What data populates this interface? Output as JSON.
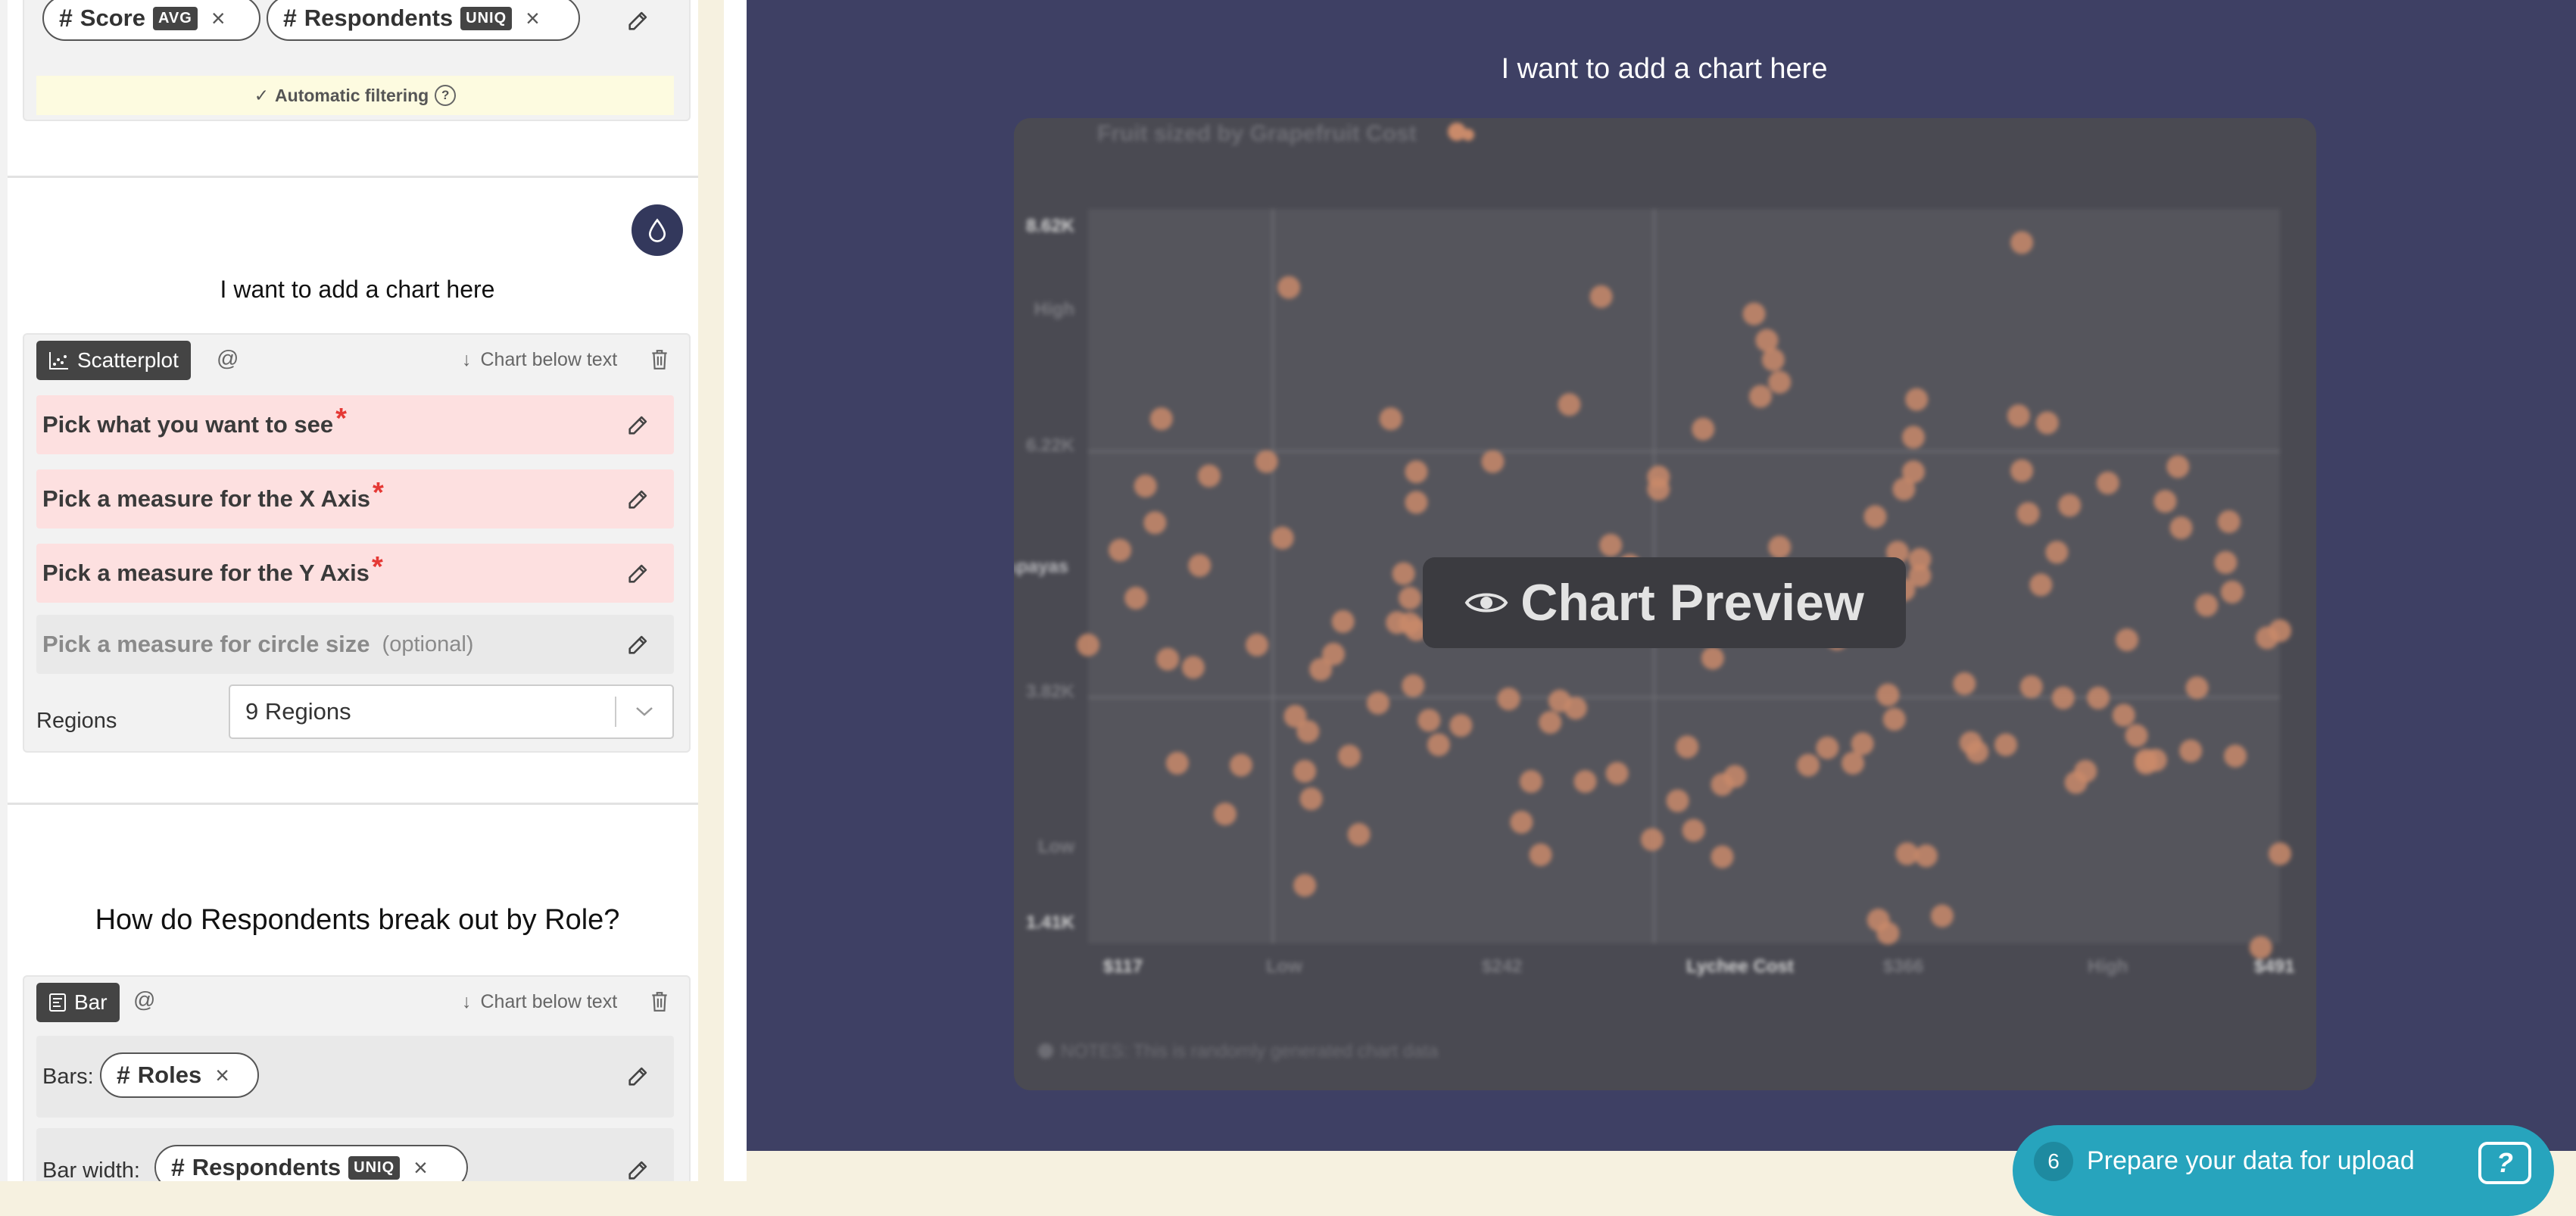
{
  "top_card": {
    "pills": [
      {
        "label": "Score",
        "tag": "AVG"
      },
      {
        "label": "Respondents",
        "tag": "UNIQ"
      }
    ],
    "auto_filter_label": "Automatic filtering"
  },
  "section1": {
    "title": "I want to add a chart here",
    "chart_type": "Scatterplot",
    "at_symbol": "@",
    "position_label": "Chart below text",
    "fields": [
      {
        "label": "Pick what you want to see",
        "required": true
      },
      {
        "label": "Pick a measure for the X Axis",
        "required": true
      },
      {
        "label": "Pick a measure for the Y Axis",
        "required": true
      }
    ],
    "optional_field": {
      "label": "Pick a measure for circle size",
      "note": "(optional)"
    },
    "regions": {
      "label": "Regions",
      "value": "9 Regions"
    }
  },
  "section2": {
    "title": "How do Respondents break out by Role?",
    "chart_type": "Bar",
    "at_symbol": "@",
    "position_label": "Chart below text",
    "bars": {
      "label": "Bars:",
      "pill": "Roles"
    },
    "bar_width": {
      "label": "Bar width:",
      "pill": "Respondents",
      "tag": "UNIQ"
    }
  },
  "preview": {
    "title": "I want to add a chart here",
    "badge": "Chart Preview",
    "icon": "eye-icon"
  },
  "chart_data": {
    "type": "scatter",
    "title": "Fruit sized by Grapefruit Cost",
    "xlabel": "Lychee Cost",
    "ylabel": "# of Papayas",
    "x_ticks": [
      "$117",
      "Low",
      "$242",
      "Lychee Cost",
      "$366",
      "High",
      "$491"
    ],
    "y_ticks": [
      "8.62K",
      "High",
      "6.22K",
      "3.82K",
      "Low",
      "1.41K"
    ],
    "xlim": [
      117,
      491
    ],
    "ylim": [
      1410,
      8620
    ],
    "note": "NOTES: This is randomly generated chart data",
    "color": "#c98a6a",
    "points": [
      [
        117,
        4340
      ],
      [
        127,
        5270
      ],
      [
        132,
        4800
      ],
      [
        135,
        5900
      ],
      [
        138,
        5540
      ],
      [
        140,
        6560
      ],
      [
        142,
        4200
      ],
      [
        145,
        3180
      ],
      [
        150,
        4120
      ],
      [
        152,
        5120
      ],
      [
        155,
        6000
      ],
      [
        160,
        2680
      ],
      [
        165,
        3160
      ],
      [
        170,
        4340
      ],
      [
        173,
        6140
      ],
      [
        178,
        5390
      ],
      [
        180,
        7850
      ],
      [
        182,
        3640
      ],
      [
        185,
        1980
      ],
      [
        185,
        3100
      ],
      [
        186,
        3490
      ],
      [
        187,
        2830
      ],
      [
        190,
        4100
      ],
      [
        194,
        4250
      ],
      [
        197,
        4570
      ],
      [
        199,
        3250
      ],
      [
        202,
        2480
      ],
      [
        208,
        3770
      ],
      [
        212,
        6560
      ],
      [
        214,
        4560
      ],
      [
        216,
        5040
      ],
      [
        218,
        4800
      ],
      [
        218,
        4550
      ],
      [
        219,
        3940
      ],
      [
        220,
        6040
      ],
      [
        220,
        4490
      ],
      [
        220,
        5740
      ],
      [
        224,
        3600
      ],
      [
        227,
        3360
      ],
      [
        234,
        3550
      ],
      [
        238,
        4590
      ],
      [
        244,
        6140
      ],
      [
        249,
        3810
      ],
      [
        253,
        2600
      ],
      [
        256,
        3000
      ],
      [
        259,
        2280
      ],
      [
        262,
        3580
      ],
      [
        265,
        3790
      ],
      [
        268,
        6700
      ],
      [
        270,
        3720
      ],
      [
        273,
        3000
      ],
      [
        278,
        7760
      ],
      [
        281,
        5000
      ],
      [
        281,
        5320
      ],
      [
        283,
        3080
      ],
      [
        283,
        4790
      ],
      [
        287,
        5120
      ],
      [
        290,
        5030
      ],
      [
        292,
        4870
      ],
      [
        293,
        4830
      ],
      [
        294,
        2430
      ],
      [
        296,
        5870
      ],
      [
        296,
        5990
      ],
      [
        298,
        4590
      ],
      [
        302,
        4670
      ],
      [
        302,
        2810
      ],
      [
        305,
        3340
      ],
      [
        307,
        2520
      ],
      [
        310,
        6460
      ],
      [
        311,
        4650
      ],
      [
        313,
        4210
      ],
      [
        316,
        2260
      ],
      [
        316,
        2970
      ],
      [
        319,
        4550
      ],
      [
        320,
        3050
      ],
      [
        326,
        7590
      ],
      [
        328,
        6780
      ],
      [
        330,
        7330
      ],
      [
        332,
        7140
      ],
      [
        334,
        5300
      ],
      [
        334,
        6920
      ],
      [
        336,
        4940
      ],
      [
        338,
        4700
      ],
      [
        343,
        3160
      ],
      [
        345,
        4880
      ],
      [
        349,
        3330
      ],
      [
        352,
        4400
      ],
      [
        357,
        3180
      ],
      [
        360,
        3370
      ],
      [
        364,
        5600
      ],
      [
        365,
        1640
      ],
      [
        368,
        1510
      ],
      [
        368,
        3850
      ],
      [
        370,
        3610
      ],
      [
        371,
        5250
      ],
      [
        373,
        5870
      ],
      [
        373,
        4880
      ],
      [
        374,
        2290
      ],
      [
        376,
        6380
      ],
      [
        376,
        6040
      ],
      [
        377,
        6750
      ],
      [
        378,
        5020
      ],
      [
        378,
        5180
      ],
      [
        380,
        2270
      ],
      [
        385,
        1680
      ],
      [
        392,
        3960
      ],
      [
        394,
        3380
      ],
      [
        396,
        3290
      ],
      [
        405,
        3360
      ],
      [
        409,
        6590
      ],
      [
        410,
        8290
      ],
      [
        410,
        6050
      ],
      [
        412,
        5630
      ],
      [
        413,
        3930
      ],
      [
        416,
        4930
      ],
      [
        418,
        6520
      ],
      [
        421,
        5250
      ],
      [
        423,
        3820
      ],
      [
        425,
        5710
      ],
      [
        427,
        2990
      ],
      [
        430,
        3100
      ],
      [
        434,
        3820
      ],
      [
        437,
        5930
      ],
      [
        442,
        3650
      ],
      [
        443,
        4390
      ],
      [
        446,
        3450
      ],
      [
        449,
        3210
      ],
      [
        449,
        3180
      ],
      [
        452,
        3210
      ],
      [
        455,
        5750
      ],
      [
        459,
        6090
      ],
      [
        460,
        5490
      ],
      [
        463,
        3300
      ],
      [
        465,
        3920
      ],
      [
        468,
        4730
      ],
      [
        474,
        5150
      ],
      [
        475,
        5550
      ],
      [
        476,
        4860
      ],
      [
        477,
        3250
      ],
      [
        485,
        1370
      ],
      [
        487,
        4410
      ],
      [
        491,
        4480
      ],
      [
        491,
        2290
      ]
    ]
  },
  "upload_cta": {
    "count": "6",
    "label": "Prepare your data for upload"
  }
}
